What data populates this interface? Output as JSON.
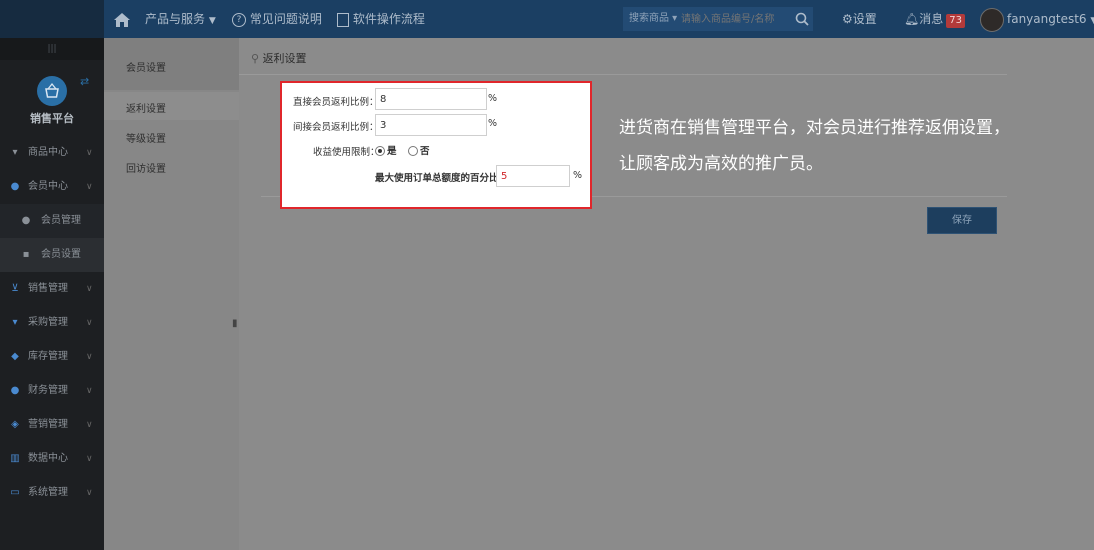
{
  "topbar": {
    "products_label": "产品与服务",
    "faq_label": "常见问题说明",
    "flow_label": "软件操作流程",
    "search_category": "搜索商品",
    "search_placeholder": "请输入商品编号/名称",
    "settings_label": "设置",
    "messages_label": "消息",
    "messages_count": "73",
    "username": "fanyangtest6"
  },
  "sidebar": {
    "handle": "|||",
    "title": "销售平台",
    "items": [
      {
        "label": "商品中心",
        "icon": "basket-icon"
      },
      {
        "label": "会员中心",
        "icon": "user-icon"
      },
      {
        "label": "会员管理",
        "icon": "users-icon"
      },
      {
        "label": "会员设置",
        "icon": "settings-card-icon"
      },
      {
        "label": "销售管理",
        "icon": "cart-icon"
      },
      {
        "label": "采购管理",
        "icon": "purchase-basket-icon"
      },
      {
        "label": "库存管理",
        "icon": "box-icon"
      },
      {
        "label": "财务管理",
        "icon": "coin-icon"
      },
      {
        "label": "营销管理",
        "icon": "tag-icon"
      },
      {
        "label": "数据中心",
        "icon": "bar-chart-icon"
      },
      {
        "label": "系统管理",
        "icon": "monitor-icon"
      }
    ]
  },
  "subnav": {
    "header": "会员设置",
    "items": [
      "返利设置",
      "等级设置",
      "回访设置"
    ]
  },
  "main": {
    "breadcrumb": "返利设置",
    "save_label": "保存"
  },
  "form": {
    "direct_label": "直接会员返利比例：",
    "direct_value": "8",
    "indirect_label": "间接会员返利比例：",
    "indirect_value": "3",
    "percent": "%",
    "limit_label": "收益使用限制：",
    "yes_label": "是",
    "no_label": "否",
    "yes_selected": true,
    "max_label": "最大使用订单总额度的百分比",
    "max_value": "5"
  },
  "annotation": {
    "line1": "进货商在销售管理平台，对会员进行推荐返佣设置，",
    "line2": "让顾客成为高效的推广员。"
  }
}
